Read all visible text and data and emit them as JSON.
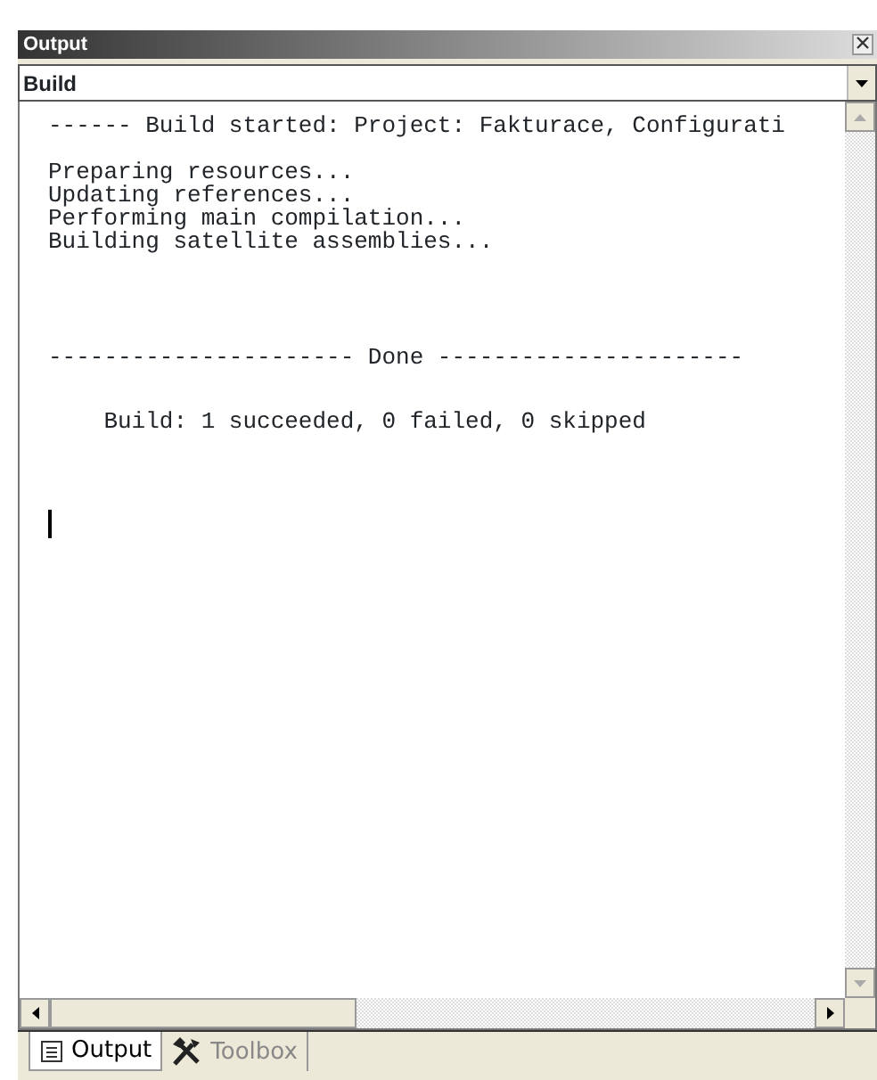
{
  "window": {
    "title": "Output"
  },
  "dropdown": {
    "value": "Build"
  },
  "output_blocks": [
    [
      "------ Build started: Project: Fakturace, Configurati"
    ],
    [
      "Preparing resources...",
      "Updating references...",
      "Performing main compilation...",
      "Building satellite assemblies..."
    ],
    [
      "---------------------- Done ----------------------"
    ],
    [
      "    Build: 1 succeeded, 0 failed, 0 skipped"
    ]
  ],
  "tabs": [
    {
      "label": "Output",
      "selected": true
    },
    {
      "label": "Toolbox",
      "selected": false
    }
  ]
}
